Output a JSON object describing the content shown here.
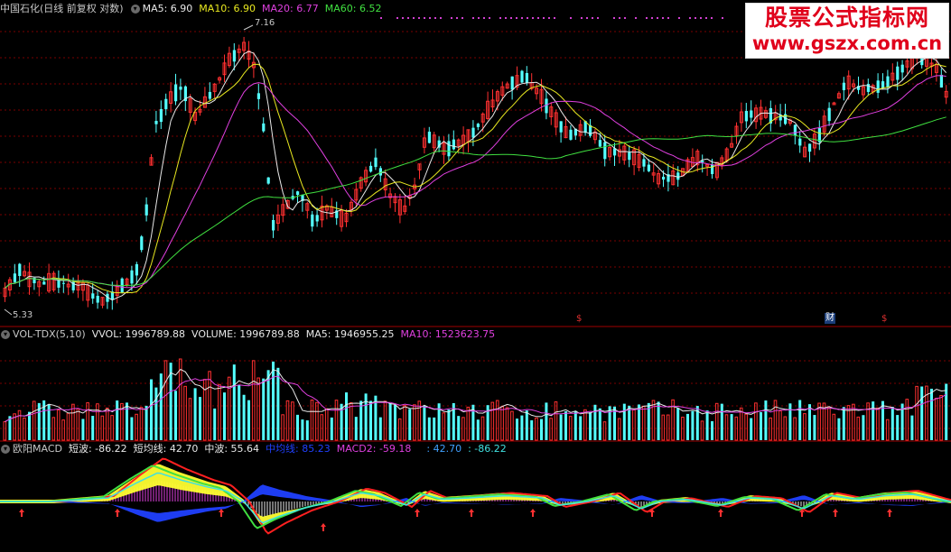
{
  "price_panel": {
    "title": "中国石化(日线 前复权 对数)",
    "indicators": [
      {
        "label": "MA5: 6.90",
        "color": "#e8e8e8"
      },
      {
        "label": "MA10: 6.90",
        "color": "#e8e820"
      },
      {
        "label": "MA20: 6.77",
        "color": "#e040e0"
      },
      {
        "label": "MA60: 6.52",
        "color": "#40e040"
      }
    ],
    "high_label": "7.16",
    "low_label": "5.33",
    "markers": [
      {
        "text": "$",
        "color": "#e03030"
      },
      {
        "text": "财",
        "color": "#ffffff"
      },
      {
        "text": "$",
        "color": "#e03030"
      }
    ]
  },
  "volume_panel": {
    "title": "VOL-TDX(5,10)",
    "indicators": [
      {
        "label": "VVOL: 1996789.88",
        "color": "#e8e8e8"
      },
      {
        "label": "VOLUME: 1996789.88",
        "color": "#e8e8e8"
      },
      {
        "label": "MA5: 1946955.25",
        "color": "#e8e8e8"
      },
      {
        "label": "MA10: 1523623.75",
        "color": "#e040e0"
      }
    ]
  },
  "macd_panel": {
    "title": "欧阳MACD",
    "indicators": [
      {
        "label": "短波: -86.22",
        "color": "#e8e8e8"
      },
      {
        "label": "短均线: 42.70",
        "color": "#e8e8e8"
      },
      {
        "label": "中波: 55.64",
        "color": "#e8e8e8"
      },
      {
        "label": "中均线: 85.23",
        "color": "#2040ff"
      },
      {
        "label": "MACD2: -59.18",
        "color": "#e040e0"
      },
      {
        "label": ": 42.70",
        "color": "#40a0ff"
      },
      {
        "label": ": -86.22",
        "color": "#40e0e0"
      }
    ]
  },
  "watermark": {
    "line1": "股票公式指标网",
    "line2": "www.gszx.com.cn"
  },
  "colors": {
    "up": "#ff3030",
    "down": "#54ffff",
    "ma5": "#e8e8e8",
    "ma10": "#e8e820",
    "ma20": "#e040e0",
    "ma60": "#40e040",
    "grid": "#7a0000"
  }
}
